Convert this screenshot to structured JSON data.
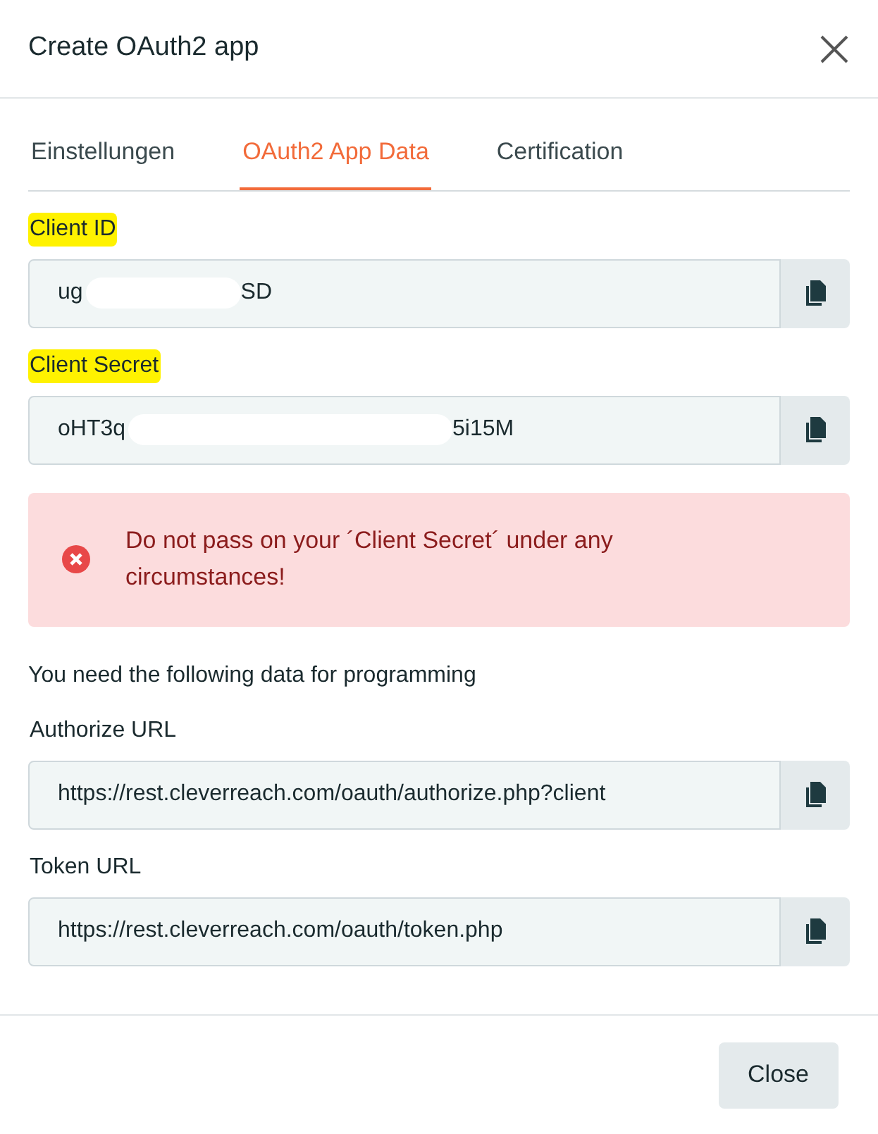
{
  "dialog": {
    "title": "Create OAuth2 app"
  },
  "tabs": [
    {
      "label": "Einstellungen",
      "selected": false
    },
    {
      "label": "OAuth2 App Data",
      "selected": true
    },
    {
      "label": "Certification",
      "selected": false
    }
  ],
  "fields": [
    {
      "label": "Client ID",
      "highlighted": true,
      "value_start": "ug",
      "value_end": "SD",
      "redacted": true
    },
    {
      "label": "Client Secret",
      "highlighted": true,
      "value_start": "oHT3q",
      "value_end": "5i15M",
      "redacted": true
    }
  ],
  "alert": {
    "text": "Do not pass on your ´Client Secret´ under any circumstances!"
  },
  "intro": "You need the following data for programming",
  "urls": [
    {
      "label": "Authorize URL",
      "highlighted": false,
      "value_start": "https://rest.cleverreach.com/oauth/authorize.php?client"
    },
    {
      "label": "Token URL",
      "highlighted": false,
      "value_start": "https://rest.cleverreach.com/oauth/token.php"
    }
  ],
  "footer": {
    "close_button": "Close"
  }
}
